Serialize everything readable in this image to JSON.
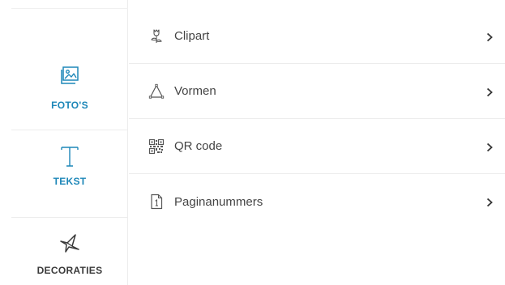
{
  "sidebar": {
    "items": [
      {
        "id": "fotos",
        "label": "FOTO'S",
        "icon": "photos-icon",
        "active": true
      },
      {
        "id": "tekst",
        "label": "TEKST",
        "icon": "text-icon",
        "active": true
      },
      {
        "id": "decoraties",
        "label": "DECORATIES",
        "icon": "decorations-icon",
        "active": false
      }
    ]
  },
  "menu": {
    "items": [
      {
        "label": "Clipart",
        "icon": "clipart-icon"
      },
      {
        "label": "Vormen",
        "icon": "shapes-icon"
      },
      {
        "label": "QR code",
        "icon": "qr-code-icon"
      },
      {
        "label": "Paginanummers",
        "icon": "page-number-icon"
      }
    ]
  },
  "colors": {
    "accent": "#1d87b8",
    "text": "#444444",
    "divider": "#ececec"
  }
}
